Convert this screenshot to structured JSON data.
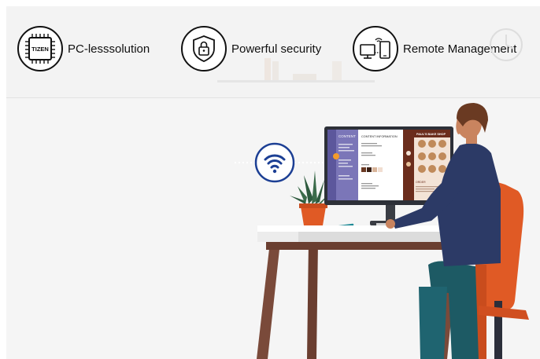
{
  "features": [
    {
      "icon": "tizen-chip-icon",
      "label": "PC-lesssolution",
      "chip_text": "TIZEN"
    },
    {
      "icon": "shield-lock-icon",
      "label": "Powerful security"
    },
    {
      "icon": "remote-devices-icon",
      "label": "Remote Management"
    }
  ],
  "monitor_screen": {
    "sidebar_title": "CONTENT",
    "panel_title": "CONTENT INFORMATION",
    "menu_title": "PAUL'S BAKE SHOP",
    "order_label": "ORDER"
  },
  "colors": {
    "wifi_blue": "#1c3f94",
    "sidebar_purple": "#7b76b8",
    "menu_brown": "#6b2d1c",
    "chair_orange": "#e05a25",
    "desk_brown": "#7a4a3a"
  }
}
